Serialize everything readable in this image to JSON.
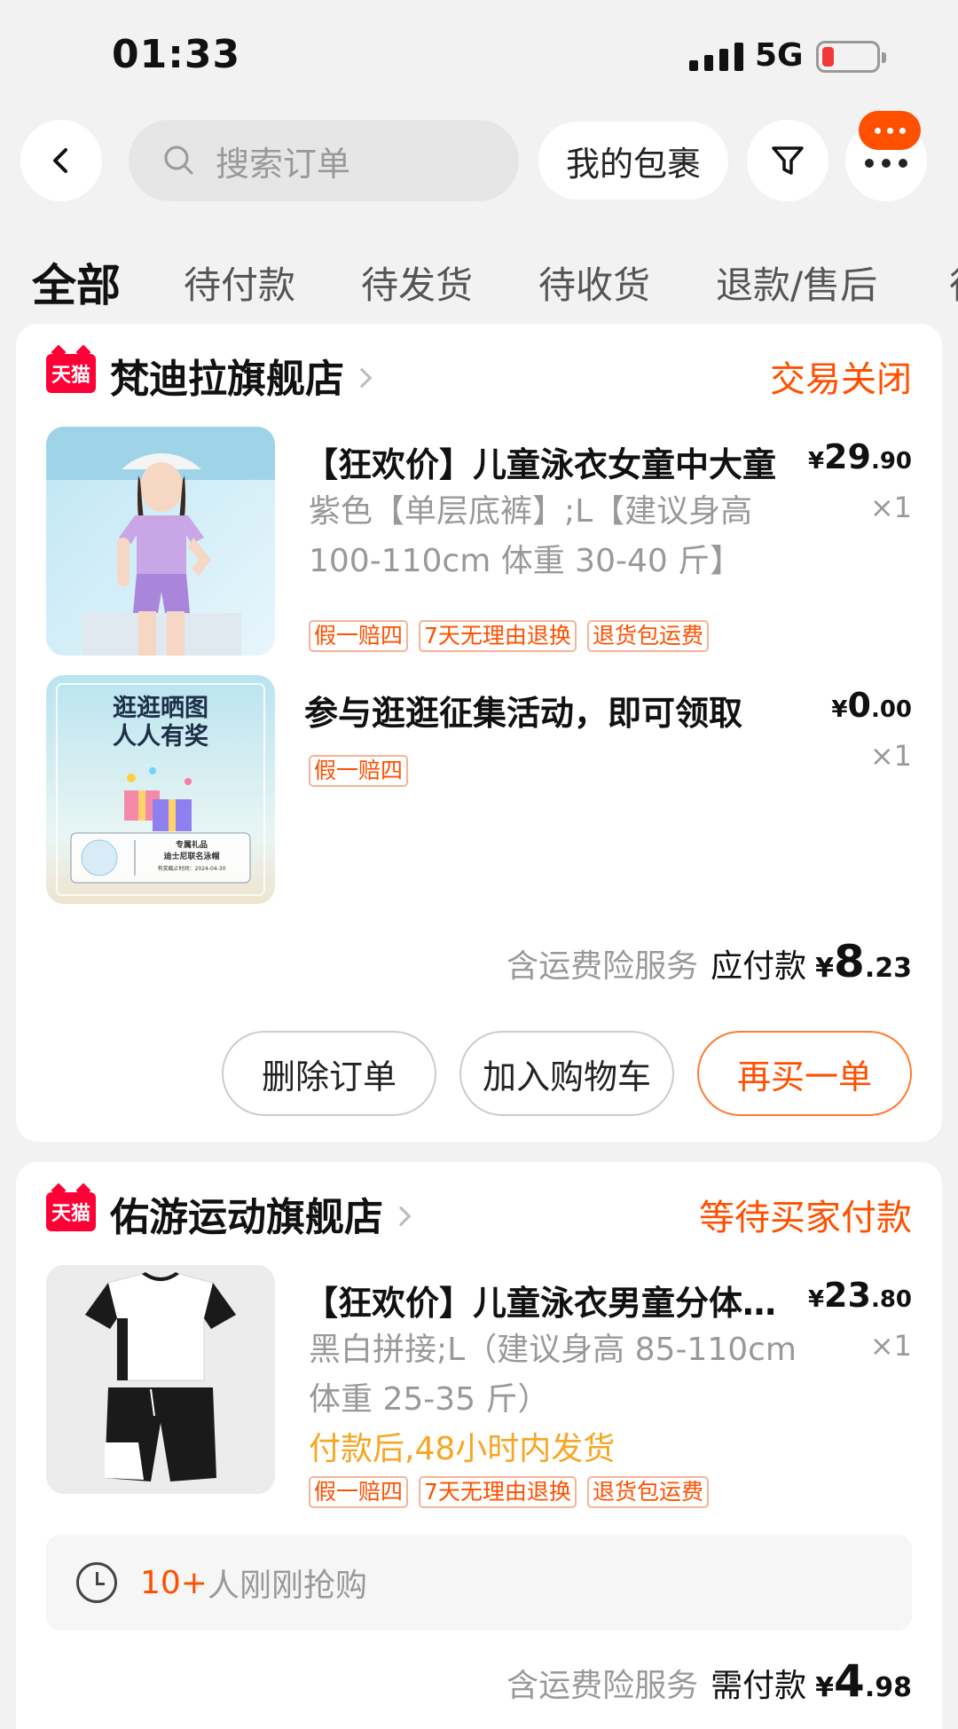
{
  "status_bar": {
    "time": "01:33",
    "network": "5G"
  },
  "topnav": {
    "search_placeholder": "搜索订单",
    "my_packages": "我的包裹"
  },
  "tabs": [
    {
      "label": "全部",
      "active": true
    },
    {
      "label": "待付款"
    },
    {
      "label": "待发货"
    },
    {
      "label": "待收货"
    },
    {
      "label": "退款/售后"
    }
  ],
  "orders": [
    {
      "platform_logo": "天猫",
      "shop_name": "梵迪拉旗舰店",
      "status": "交易关闭",
      "items": [
        {
          "title": "【狂欢价】儿童泳衣女童中大童",
          "sku": "紫色【单层底裤】;L【建议身高 100-110cm 体重 30-40 斤】",
          "price_currency": "¥",
          "price_int": "29",
          "price_dec": ".90",
          "qty": "×1",
          "tags": [
            "假一赔四",
            "7天无理由退换",
            "退货包运费"
          ]
        },
        {
          "title": "参与逛逛征集活动，即可领取",
          "price_currency": "¥",
          "price_int": "0",
          "price_dec": ".00",
          "qty": "×1",
          "tags": [
            "假一赔四"
          ],
          "image_text": {
            "headline_1": "逛逛晒图",
            "headline_2": "人人有奖",
            "gift_1": "专属礼品",
            "gift_2": "迪士尼联名泳帽",
            "deadline": "有奖截止时间：2024-04-30"
          }
        }
      ],
      "total": {
        "service": "含运费险服务",
        "label": "应付款",
        "currency": "¥",
        "int": "8",
        "dec": ".23"
      },
      "buttons": [
        "删除订单",
        "加入购物车",
        "再买一单"
      ]
    },
    {
      "platform_logo": "天猫",
      "shop_name": "佑游运动旗舰店",
      "status": "等待买家付款",
      "items": [
        {
          "title": "【狂欢价】儿童泳衣男童分体套装",
          "sku": "黑白拼接;L（建议身高 85-110cm 体重 25-35 斤）",
          "ship_hint": "付款后,48小时内发货",
          "price_currency": "¥",
          "price_int": "23",
          "price_dec": ".80",
          "qty": "×1",
          "tags": [
            "假一赔四",
            "7天无理由退换",
            "退货包运费"
          ]
        }
      ],
      "social_proof": {
        "count": "10+",
        "text": "人刚刚抢购"
      },
      "total": {
        "service": "含运费险服务",
        "label": "需付款",
        "currency": "¥",
        "int": "4",
        "dec": ".98"
      }
    }
  ],
  "colors": {
    "accent": "#ff5000",
    "tmall_red": "#ff0036",
    "ship_hint": "#f5a623"
  }
}
